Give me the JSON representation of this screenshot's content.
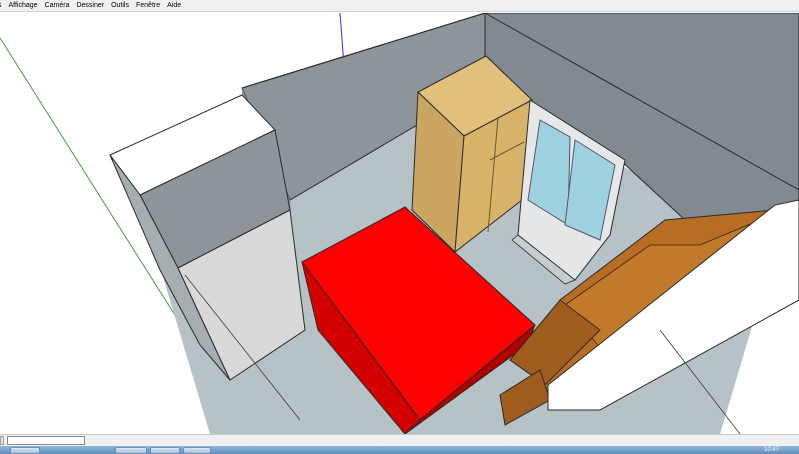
{
  "menu": {
    "items": [
      "s",
      "Affichage",
      "Caméra",
      "Dessiner",
      "Outils",
      "Fenêtre",
      "Aide"
    ]
  },
  "statusbar": {
    "measurements_value": ""
  },
  "taskbar": {
    "clock": "10:47"
  },
  "colors": {
    "wall": "#8e959a",
    "floor": "#b7c2c7",
    "bed": "#ff0000",
    "wardrobe": "#d8b46a",
    "window_glass": "#9fd2e0",
    "furniture": "#b76d24",
    "blue_axis": "#2d2dd8",
    "green_axis": "#3fa23f"
  }
}
